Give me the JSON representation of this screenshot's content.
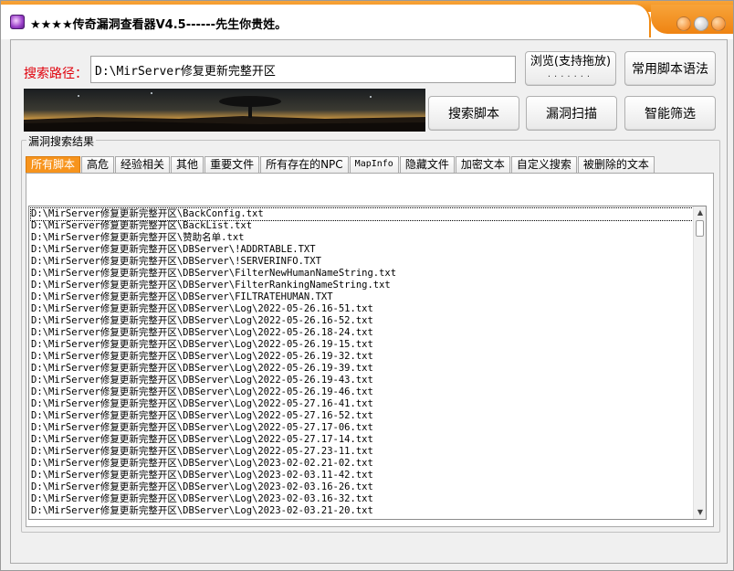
{
  "window": {
    "title": "★★★★传奇漏洞查看器V4.5------先生你贵姓。"
  },
  "search": {
    "label": "搜索路径：",
    "path_value": "D:\\MirServer修复更新完整开区"
  },
  "buttons": {
    "browse_label": "浏览(支持拖放)",
    "browse_dots": ".......",
    "syntax_label": "常用脚本语法",
    "search_label": "搜索脚本",
    "scan_label": "漏洞扫描",
    "filter_label": "智能筛选"
  },
  "results": {
    "group_title": "漏洞搜索结果",
    "tabs": [
      {
        "label": "所有脚本"
      },
      {
        "label": "高危"
      },
      {
        "label": "经验相关"
      },
      {
        "label": "其他"
      },
      {
        "label": "重要文件"
      },
      {
        "label": "所有存在的NPC"
      },
      {
        "label": "MapInfo"
      },
      {
        "label": "隐藏文件"
      },
      {
        "label": "加密文本"
      },
      {
        "label": "自定义搜索"
      },
      {
        "label": "被删除的文本"
      }
    ],
    "active_tab": "所有脚本",
    "items": [
      "D:\\MirServer修复更新完整开区\\BackConfig.txt",
      "D:\\MirServer修复更新完整开区\\BackList.txt",
      "D:\\MirServer修复更新完整开区\\赞助名单.txt",
      "D:\\MirServer修复更新完整开区\\DBServer\\!ADDRTABLE.TXT",
      "D:\\MirServer修复更新完整开区\\DBServer\\!SERVERINFO.TXT",
      "D:\\MirServer修复更新完整开区\\DBServer\\FilterNewHumanNameString.txt",
      "D:\\MirServer修复更新完整开区\\DBServer\\FilterRankingNameString.txt",
      "D:\\MirServer修复更新完整开区\\DBServer\\FILTRATEHUMAN.TXT",
      "D:\\MirServer修复更新完整开区\\DBServer\\Log\\2022-05-26.16-51.txt",
      "D:\\MirServer修复更新完整开区\\DBServer\\Log\\2022-05-26.16-52.txt",
      "D:\\MirServer修复更新完整开区\\DBServer\\Log\\2022-05-26.18-24.txt",
      "D:\\MirServer修复更新完整开区\\DBServer\\Log\\2022-05-26.19-15.txt",
      "D:\\MirServer修复更新完整开区\\DBServer\\Log\\2022-05-26.19-32.txt",
      "D:\\MirServer修复更新完整开区\\DBServer\\Log\\2022-05-26.19-39.txt",
      "D:\\MirServer修复更新完整开区\\DBServer\\Log\\2022-05-26.19-43.txt",
      "D:\\MirServer修复更新完整开区\\DBServer\\Log\\2022-05-26.19-46.txt",
      "D:\\MirServer修复更新完整开区\\DBServer\\Log\\2022-05-27.16-41.txt",
      "D:\\MirServer修复更新完整开区\\DBServer\\Log\\2022-05-27.16-52.txt",
      "D:\\MirServer修复更新完整开区\\DBServer\\Log\\2022-05-27.17-06.txt",
      "D:\\MirServer修复更新完整开区\\DBServer\\Log\\2022-05-27.17-14.txt",
      "D:\\MirServer修复更新完整开区\\DBServer\\Log\\2022-05-27.23-11.txt",
      "D:\\MirServer修复更新完整开区\\DBServer\\Log\\2023-02-02.21-02.txt",
      "D:\\MirServer修复更新完整开区\\DBServer\\Log\\2023-02-03.11-42.txt",
      "D:\\MirServer修复更新完整开区\\DBServer\\Log\\2023-02-03.16-26.txt",
      "D:\\MirServer修复更新完整开区\\DBServer\\Log\\2023-02-03.16-32.txt",
      "D:\\MirServer修复更新完整开区\\DBServer\\Log\\2023-02-03.21-20.txt"
    ]
  },
  "icons": {
    "app": "app-icon",
    "minimize": "minimize-icon",
    "maximize": "maximize-icon",
    "close": "close-icon"
  },
  "colors": {
    "accent": "#f7941d",
    "label_red": "#e0000b"
  }
}
